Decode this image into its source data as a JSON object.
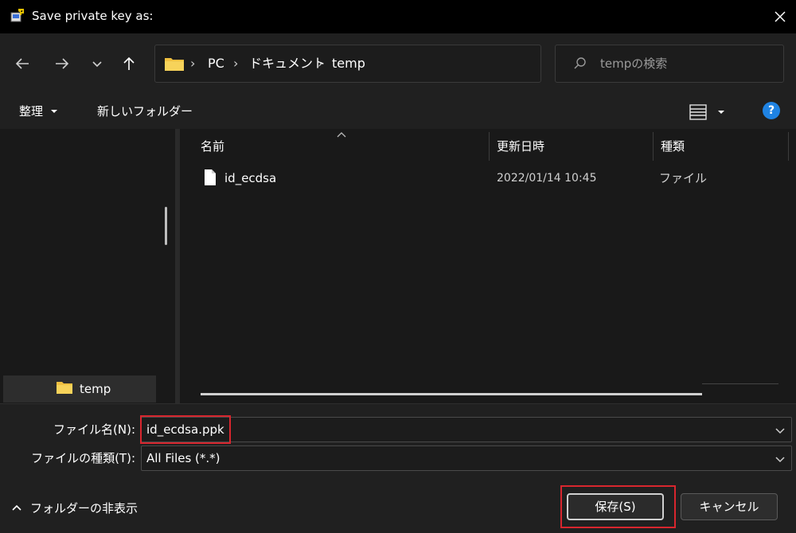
{
  "window": {
    "title": "Save private key as:"
  },
  "nav": {
    "breadcrumb": [
      "PC",
      "ドキュメント",
      "temp"
    ],
    "search_placeholder": "tempの検索"
  },
  "toolbar": {
    "organize_label": "整理",
    "new_folder_label": "新しいフォルダー"
  },
  "navpane": {
    "selected_folder": "temp"
  },
  "files": {
    "columns": [
      "名前",
      "更新日時",
      "種類"
    ],
    "rows": [
      {
        "name": "id_ecdsa",
        "modified": "2022/01/14 10:45",
        "type": "ファイル"
      }
    ]
  },
  "form": {
    "filename_label": "ファイル名(N):",
    "filename_value": "id_ecdsa.ppk",
    "filetype_label": "ファイルの種類(T):",
    "filetype_value": "All Files (*.*)",
    "hide_folders_label": "フォルダーの非表示",
    "save_label": "保存(S)",
    "cancel_label": "キャンセル"
  },
  "colors": {
    "accent": "#1f83e3",
    "highlight": "#d8262e",
    "folder": "#f0c040"
  },
  "icons": [
    "app-key-icon",
    "close-icon",
    "back-arrow-icon",
    "forward-arrow-icon",
    "chevron-down-icon",
    "up-arrow-icon",
    "folder-icon",
    "refresh-icon",
    "search-icon",
    "view-list-icon",
    "help-icon",
    "file-icon",
    "chevron-up-icon"
  ]
}
